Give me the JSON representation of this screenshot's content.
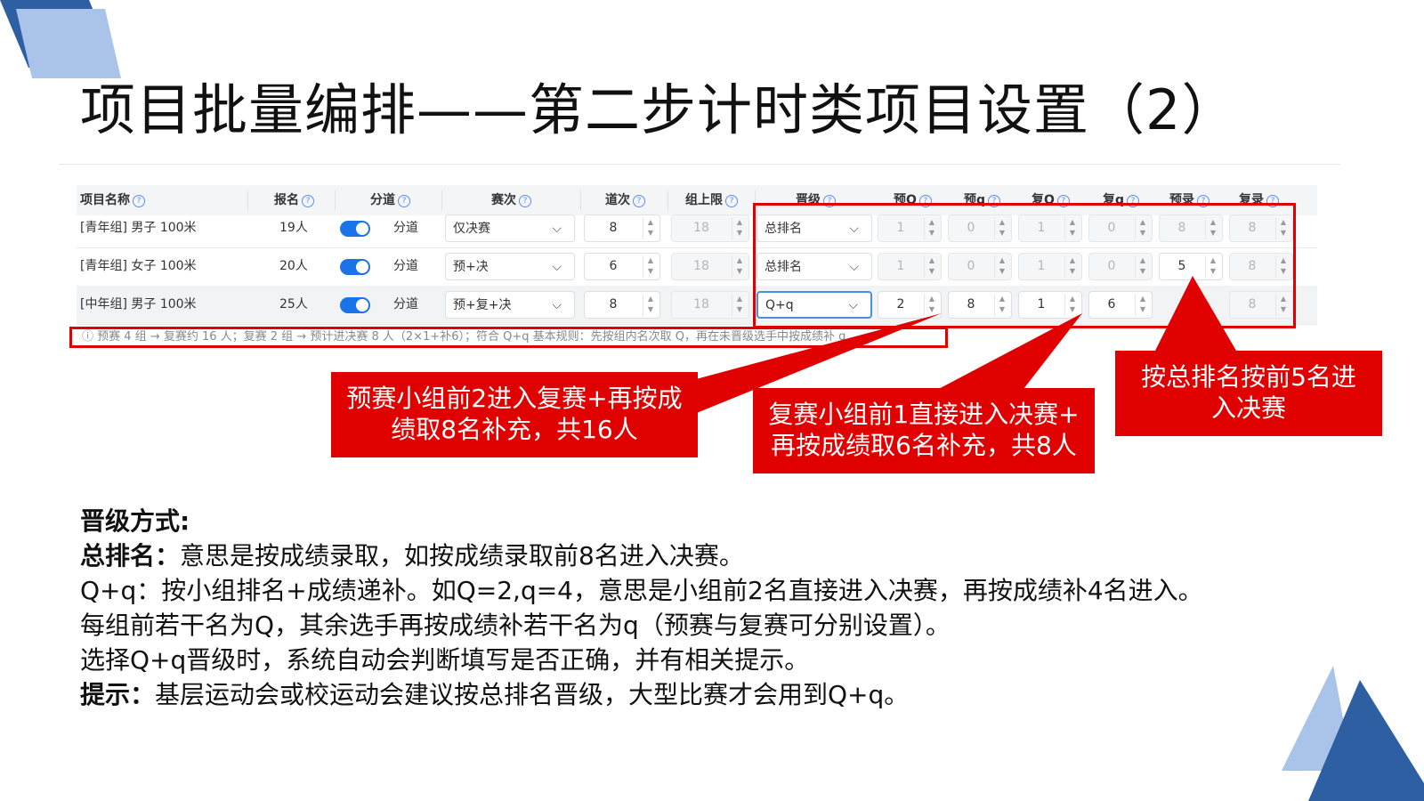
{
  "slide": {
    "title": "项目批量编排——第二步计时类项目设置（2）",
    "accent_dark": "#2e5fa3",
    "accent_light": "#a9c4e8",
    "highlight_red": "#e00000"
  },
  "table": {
    "headers": [
      "项目名称",
      "报名",
      "分道",
      "赛次",
      "道次",
      "组上限",
      "晋级",
      "预Q",
      "预q",
      "复Q",
      "复q",
      "预录",
      "复录"
    ],
    "help_icon": "question-circle-icon",
    "rows": [
      {
        "name": "[青年组] 男子 100米",
        "count": "19人",
        "lane_label": "分道",
        "round": "仅决赛",
        "lanes": "8",
        "group_limit": "18",
        "advance": "总排名",
        "pre_Q": "1",
        "pre_q": "0",
        "semi_Q": "1",
        "semi_q": "0",
        "pre_rec": "8",
        "semi_rec": "8"
      },
      {
        "name": "[青年组] 女子 100米",
        "count": "20人",
        "lane_label": "分道",
        "round": "预+决",
        "lanes": "6",
        "group_limit": "18",
        "advance": "总排名",
        "pre_Q": "1",
        "pre_q": "0",
        "semi_Q": "1",
        "semi_q": "0",
        "pre_rec": "5",
        "semi_rec": "8"
      },
      {
        "name": "[中年组] 男子 100米",
        "count": "25人",
        "lane_label": "分道",
        "round": "预+复+决",
        "lanes": "8",
        "group_limit": "18",
        "advance": "Q+q",
        "pre_Q": "2",
        "pre_q": "8",
        "semi_Q": "1",
        "semi_q": "6",
        "pre_rec": "",
        "semi_rec": "8"
      }
    ],
    "hint": "ⓘ 预赛 4 组 → 复赛约 16 人；复赛 2 组 → 预计进决赛 8 人（2×1+补6）；符合 Q+q 基本规则：先按组内名次取 Q，再在未晋级选手中按成绩补 q"
  },
  "callouts": {
    "pre": [
      "预赛小组前2进入复赛+再按成",
      "绩取8名补充，共16人"
    ],
    "semi": [
      "复赛小组前1直接进入决赛+",
      "再按成绩取6名补充，共8人"
    ],
    "rank": [
      "按总排名按前5名进",
      "入决赛"
    ]
  },
  "notes": {
    "heading": "晋级方式:",
    "l1_bold": "总排名：",
    "l1": "意思是按成绩录取，如按成绩录取前8名进入决赛。",
    "l2": "Q+q：按小组排名+成绩递补。如Q=2,q=4，意思是小组前2名直接进入决赛，再按成绩补4名进入。",
    "l3": "每组前若干名为Q，其余选手再按成绩补若干名为q（预赛与复赛可分别设置）。",
    "l4": "选择Q+q晋级时，系统自动会判断填写是否正确，并有相关提示。",
    "l5_bold": "提示：",
    "l5": "基层运动会或校运动会建议按总排名晋级，大型比赛才会用到Q+q。"
  }
}
